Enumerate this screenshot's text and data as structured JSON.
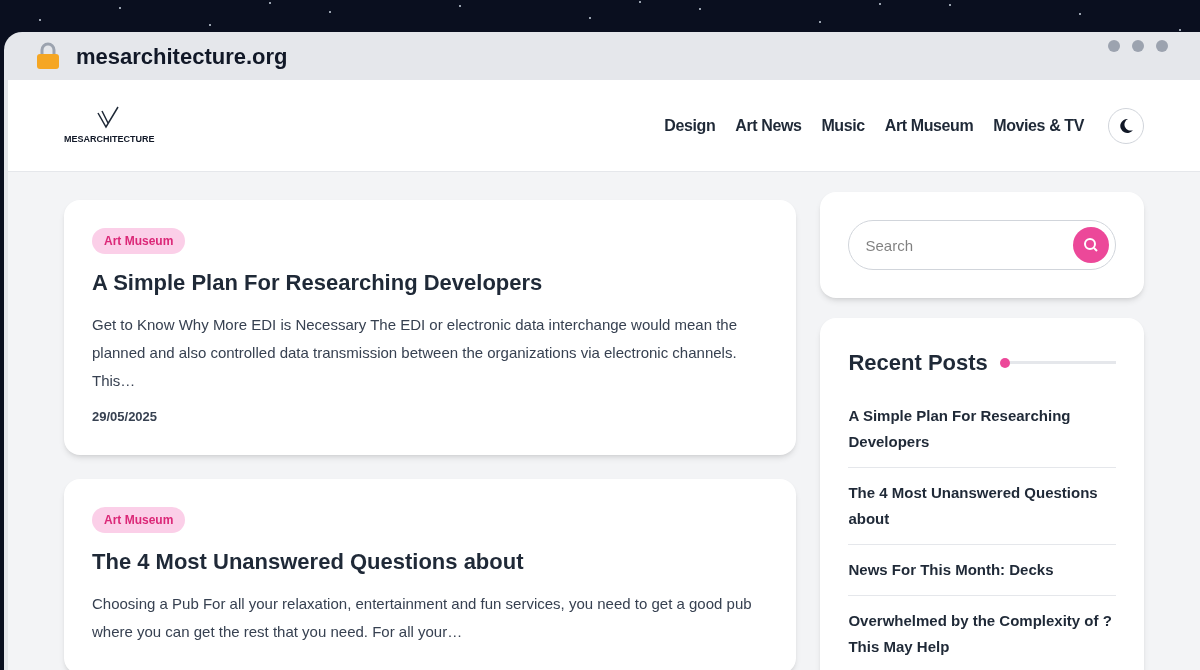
{
  "browser": {
    "url": "mesarchitecture.org"
  },
  "header": {
    "logo": "MESARCHITECTURE",
    "nav": [
      "Design",
      "Art News",
      "Music",
      "Art Museum",
      "Movies & TV"
    ]
  },
  "posts": [
    {
      "category": "Art Museum",
      "title": "A Simple Plan For Researching Developers",
      "excerpt": "Get to Know Why More EDI is Necessary The EDI or electronic data interchange would mean the planned and also controlled data transmission between the organizations via electronic channels. This…",
      "date": "29/05/2025"
    },
    {
      "category": "Art Museum",
      "title": "The 4 Most Unanswered Questions about",
      "excerpt": "Choosing a Pub For all your relaxation, entertainment and fun services, you need to get a good pub where you can get the rest that you need. For all your…"
    }
  ],
  "sidebar": {
    "search": {
      "placeholder": "Search"
    },
    "recent_posts": {
      "title": "Recent Posts",
      "items": [
        "A Simple Plan For Researching Developers",
        "The 4 Most Unanswered Questions about",
        "News For This Month: Decks",
        "Overwhelmed by the Complexity of ? This May Help"
      ]
    }
  }
}
